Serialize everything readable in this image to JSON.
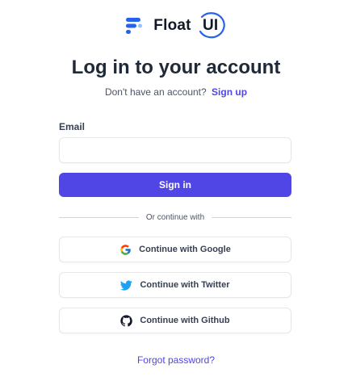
{
  "brand": {
    "name": "Float",
    "suffix": "UI",
    "color": "#2563eb"
  },
  "heading": "Log in to your account",
  "subheading": {
    "text": "Don't have an account?",
    "link": "Sign up"
  },
  "form": {
    "email_label": "Email",
    "email_value": "",
    "email_placeholder": "",
    "submit_label": "Sign in"
  },
  "divider_text": "Or continue with",
  "social": [
    {
      "label": "Continue with Google",
      "icon": "google-icon"
    },
    {
      "label": "Continue with Twitter",
      "icon": "twitter-icon"
    },
    {
      "label": "Continue with Github",
      "icon": "github-icon"
    }
  ],
  "forgot_password": "Forgot password?",
  "colors": {
    "primary": "#4f46e5",
    "border": "#e5e7eb",
    "text": "#1f2937"
  }
}
